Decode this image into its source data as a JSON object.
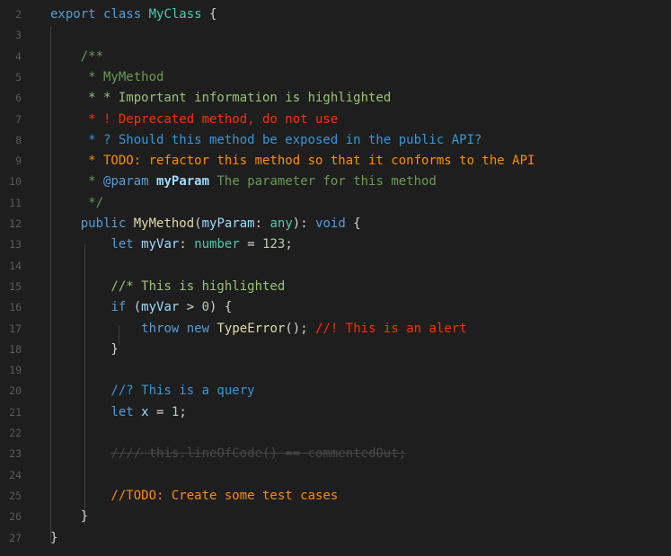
{
  "colors": {
    "background": "#1e1e1e",
    "keyword": "#569cd6",
    "type": "#4ec9b0",
    "function": "#dcdcaa",
    "variable": "#9cdcfe",
    "number": "#b5cea8",
    "comment": "#6a9955",
    "highlight": "#98c379",
    "alert": "#ff2d00",
    "query": "#3498db",
    "todo": "#ff8c00",
    "strike": "#474747",
    "line_number": "#5a5a5a"
  },
  "lines": [
    {
      "num": "2",
      "tokens": [
        {
          "t": "export ",
          "c": "#569cd6"
        },
        {
          "t": "class ",
          "c": "#569cd6"
        },
        {
          "t": "MyClass",
          "c": "#4ec9b0"
        },
        {
          "t": " {",
          "c": "#d4d4d4"
        }
      ]
    },
    {
      "num": "3",
      "tokens": []
    },
    {
      "num": "4",
      "tokens": [
        {
          "t": "    /**",
          "c": "#6a9955"
        }
      ]
    },
    {
      "num": "5",
      "tokens": [
        {
          "t": "     * MyMethod",
          "c": "#6a9955"
        }
      ]
    },
    {
      "num": "6",
      "tokens": [
        {
          "t": "     * * Important information is highlighted",
          "c": "#98c379"
        }
      ]
    },
    {
      "num": "7",
      "tokens": [
        {
          "t": "     * ! Deprecated method, do not use",
          "c": "#ff2d00"
        }
      ]
    },
    {
      "num": "8",
      "tokens": [
        {
          "t": "     * ? Should this method be exposed in the public API?",
          "c": "#3498db"
        }
      ]
    },
    {
      "num": "9",
      "tokens": [
        {
          "t": "     * TODO: refactor this method so that it conforms to the API",
          "c": "#ff8c00"
        }
      ]
    },
    {
      "num": "10",
      "tokens": [
        {
          "t": "     * ",
          "c": "#6a9955"
        },
        {
          "t": "@param",
          "c": "#569cd6"
        },
        {
          "t": " ",
          "c": "#6a9955"
        },
        {
          "t": "myParam",
          "c": "#9cdcfe",
          "b": true
        },
        {
          "t": " The parameter for this method",
          "c": "#6a9955"
        }
      ]
    },
    {
      "num": "11",
      "tokens": [
        {
          "t": "     */",
          "c": "#6a9955"
        }
      ]
    },
    {
      "num": "12",
      "tokens": [
        {
          "t": "    ",
          "c": "#d4d4d4"
        },
        {
          "t": "public",
          "c": "#569cd6"
        },
        {
          "t": " ",
          "c": "#d4d4d4"
        },
        {
          "t": "MyMethod",
          "c": "#dcdcaa"
        },
        {
          "t": "(",
          "c": "#d4d4d4"
        },
        {
          "t": "myParam",
          "c": "#9cdcfe"
        },
        {
          "t": ": ",
          "c": "#d4d4d4"
        },
        {
          "t": "any",
          "c": "#4ec9b0"
        },
        {
          "t": "): ",
          "c": "#d4d4d4"
        },
        {
          "t": "void",
          "c": "#569cd6"
        },
        {
          "t": " {",
          "c": "#d4d4d4"
        }
      ]
    },
    {
      "num": "13",
      "tokens": [
        {
          "t": "        ",
          "c": "#d4d4d4"
        },
        {
          "t": "let",
          "c": "#569cd6"
        },
        {
          "t": " ",
          "c": "#d4d4d4"
        },
        {
          "t": "myVar",
          "c": "#9cdcfe"
        },
        {
          "t": ": ",
          "c": "#d4d4d4"
        },
        {
          "t": "number",
          "c": "#4ec9b0"
        },
        {
          "t": " = ",
          "c": "#d4d4d4"
        },
        {
          "t": "123",
          "c": "#b5cea8"
        },
        {
          "t": ";",
          "c": "#d4d4d4"
        }
      ]
    },
    {
      "num": "14",
      "tokens": []
    },
    {
      "num": "15",
      "tokens": [
        {
          "t": "        //* This is highlighted",
          "c": "#98c379"
        }
      ]
    },
    {
      "num": "16",
      "tokens": [
        {
          "t": "        ",
          "c": "#d4d4d4"
        },
        {
          "t": "if",
          "c": "#569cd6"
        },
        {
          "t": " (",
          "c": "#d4d4d4"
        },
        {
          "t": "myVar",
          "c": "#9cdcfe"
        },
        {
          "t": " > ",
          "c": "#d4d4d4"
        },
        {
          "t": "0",
          "c": "#b5cea8"
        },
        {
          "t": ") {",
          "c": "#d4d4d4"
        }
      ]
    },
    {
      "num": "17",
      "tokens": [
        {
          "t": "            ",
          "c": "#d4d4d4"
        },
        {
          "t": "throw",
          "c": "#569cd6"
        },
        {
          "t": " ",
          "c": "#d4d4d4"
        },
        {
          "t": "new",
          "c": "#569cd6"
        },
        {
          "t": " ",
          "c": "#d4d4d4"
        },
        {
          "t": "TypeError",
          "c": "#dcdcaa"
        },
        {
          "t": "(); ",
          "c": "#d4d4d4"
        },
        {
          "t": "//! This is an alert",
          "c": "#ff2d00"
        }
      ]
    },
    {
      "num": "18",
      "tokens": [
        {
          "t": "        }",
          "c": "#d4d4d4"
        }
      ]
    },
    {
      "num": "19",
      "tokens": []
    },
    {
      "num": "20",
      "tokens": [
        {
          "t": "        //? This is a query",
          "c": "#3498db"
        }
      ]
    },
    {
      "num": "21",
      "tokens": [
        {
          "t": "        ",
          "c": "#d4d4d4"
        },
        {
          "t": "let",
          "c": "#569cd6"
        },
        {
          "t": " ",
          "c": "#d4d4d4"
        },
        {
          "t": "x",
          "c": "#9cdcfe"
        },
        {
          "t": " = ",
          "c": "#d4d4d4"
        },
        {
          "t": "1",
          "c": "#b5cea8"
        },
        {
          "t": ";",
          "c": "#d4d4d4"
        }
      ]
    },
    {
      "num": "22",
      "tokens": []
    },
    {
      "num": "23",
      "tokens": [
        {
          "t": "        ",
          "c": "#d4d4d4"
        },
        {
          "t": "//// this.lineOfCode() == commentedOut;",
          "c": "#474747",
          "s": true
        }
      ]
    },
    {
      "num": "24",
      "tokens": []
    },
    {
      "num": "25",
      "tokens": [
        {
          "t": "        //TODO: Create some test cases",
          "c": "#ff8c00"
        }
      ]
    },
    {
      "num": "26",
      "tokens": [
        {
          "t": "    }",
          "c": "#d4d4d4"
        }
      ]
    },
    {
      "num": "27",
      "tokens": [
        {
          "t": "}",
          "c": "#d4d4d4"
        }
      ]
    }
  ]
}
